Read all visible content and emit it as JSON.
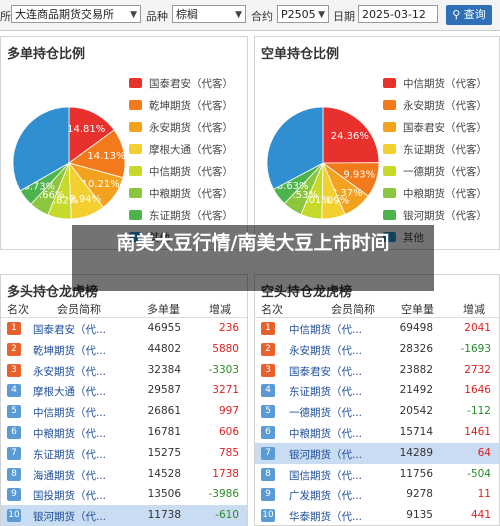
{
  "filters": {
    "exchange_prefix": "所",
    "exchange_value": "大连商品期货交易所",
    "variety_label": "品种",
    "variety_value": "棕榈",
    "contract_label": "合约",
    "contract_value": "P2505",
    "date_label": "日期",
    "date_value": "2025-03-12",
    "query_label": "查询"
  },
  "long_pie": {
    "title": "多单持仓比例",
    "slices": [
      {
        "label": "国泰君安（代客）",
        "value": 14.81,
        "color": "#e8302c"
      },
      {
        "label": "乾坤期货（代客）",
        "value": 14.13,
        "color": "#f27a1a"
      },
      {
        "label": "永安期货（代客）",
        "value": 10.21,
        "color": "#f2a21f"
      },
      {
        "label": "摩根大通（代客）",
        "value": 9.73,
        "color": "#f3d02f"
      },
      {
        "label": "中信期货（代客）",
        "value": 6.73,
        "color": "#c7d92b"
      },
      {
        "label": "中粮期货（代客）",
        "value": 5.66,
        "color": "#8cc63f"
      },
      {
        "label": "东证期货（代客）",
        "value": 4.82,
        "color": "#4db34d"
      },
      {
        "label": "其他",
        "value": 32.94,
        "color": "#2f8fd0"
      }
    ],
    "shown_labels": [
      "14.81%",
      "14.13%",
      "10.21%",
      "32.94%",
      "4.82%",
      "5.66%",
      "6.73%"
    ]
  },
  "short_pie": {
    "title": "空单持仓比例",
    "slices": [
      {
        "label": "中信期货（代客）",
        "value": 24.36,
        "color": "#e8302c"
      },
      {
        "label": "永安期货（代客）",
        "value": 9.93,
        "color": "#f27a1a"
      },
      {
        "label": "国泰君安（代客）",
        "value": 8.37,
        "color": "#f2a21f"
      },
      {
        "label": "东证期货（代客）",
        "value": 6.63,
        "color": "#f3d02f"
      },
      {
        "label": "一德期货（代客）",
        "value": 5.97,
        "color": "#c7d92b"
      },
      {
        "label": "中粮期货（代客）",
        "value": 5.53,
        "color": "#8cc63f"
      },
      {
        "label": "银河期货（代客）",
        "value": 5.01,
        "color": "#4db34d"
      },
      {
        "label": "其他",
        "value": 32.09,
        "color": "#2f8fd0"
      }
    ],
    "shown_labels": [
      "24.36%",
      "9.93%",
      "8.37%",
      "32.09%",
      "5.01%",
      "5.53%",
      "6.63%"
    ]
  },
  "overlay_text": "南美大豆行情/南美大豆上市时间",
  "long_table": {
    "title": "多头持仓龙虎榜",
    "headers": [
      "名次",
      "会员简称",
      "多单量",
      "增减"
    ],
    "rows": [
      {
        "rank": "1",
        "name": "国泰君安（代...",
        "qty": "46955",
        "change": "236"
      },
      {
        "rank": "2",
        "name": "乾坤期货（代...",
        "qty": "44802",
        "change": "5880"
      },
      {
        "rank": "3",
        "name": "永安期货（代...",
        "qty": "32384",
        "change": "-3303"
      },
      {
        "rank": "4",
        "name": "摩根大通（代...",
        "qty": "29587",
        "change": "3271"
      },
      {
        "rank": "5",
        "name": "中信期货（代...",
        "qty": "26861",
        "change": "997"
      },
      {
        "rank": "6",
        "name": "中粮期货（代...",
        "qty": "16781",
        "change": "606"
      },
      {
        "rank": "7",
        "name": "东证期货（代...",
        "qty": "15275",
        "change": "785"
      },
      {
        "rank": "8",
        "name": "海通期货（代...",
        "qty": "14528",
        "change": "1738"
      },
      {
        "rank": "9",
        "name": "国投期货（代...",
        "qty": "13506",
        "change": "-3986"
      },
      {
        "rank": "10",
        "name": "银河期货（代...",
        "qty": "11738",
        "change": "-610"
      }
    ]
  },
  "short_table": {
    "title": "空头持仓龙虎榜",
    "headers": [
      "名次",
      "会员简称",
      "空单量",
      "增减"
    ],
    "rows": [
      {
        "rank": "1",
        "name": "中信期货（代...",
        "qty": "69498",
        "change": "2041"
      },
      {
        "rank": "2",
        "name": "永安期货（代...",
        "qty": "28326",
        "change": "-1693"
      },
      {
        "rank": "3",
        "name": "国泰君安（代...",
        "qty": "23882",
        "change": "2732"
      },
      {
        "rank": "4",
        "name": "东证期货（代...",
        "qty": "21492",
        "change": "1646"
      },
      {
        "rank": "5",
        "name": "一德期货（代...",
        "qty": "20542",
        "change": "-112"
      },
      {
        "rank": "6",
        "name": "中粮期货（代...",
        "qty": "15714",
        "change": "1461"
      },
      {
        "rank": "7",
        "name": "银河期货（代...",
        "qty": "14289",
        "change": "64"
      },
      {
        "rank": "8",
        "name": "国信期货（代...",
        "qty": "11756",
        "change": "-504"
      },
      {
        "rank": "9",
        "name": "广发期货（代...",
        "qty": "9278",
        "change": "11"
      },
      {
        "rank": "10",
        "name": "华泰期货（代...",
        "qty": "9135",
        "change": "441"
      }
    ]
  },
  "rank_colors": {
    "top": "#e8602c",
    "rest": "#5b9bd5"
  },
  "highlight": {
    "long_row": "10",
    "short_row": "7"
  }
}
